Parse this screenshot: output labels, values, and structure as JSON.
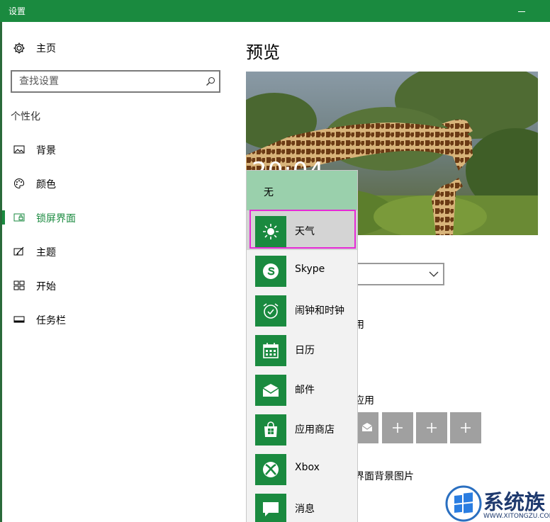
{
  "window": {
    "title": "设置"
  },
  "sidebar": {
    "home_label": "主页",
    "search_placeholder": "查找设置",
    "section_label": "个性化",
    "items": [
      {
        "label": "背景",
        "icon": "picture-icon"
      },
      {
        "label": "颜色",
        "icon": "palette-icon"
      },
      {
        "label": "锁屏界面",
        "icon": "lock-screen-icon",
        "active": true
      },
      {
        "label": "主题",
        "icon": "theme-icon"
      },
      {
        "label": "开始",
        "icon": "start-icon"
      },
      {
        "label": "任务栏",
        "icon": "taskbar-icon"
      }
    ]
  },
  "main": {
    "title": "预览",
    "preview_clock": "20:04",
    "partial_texts": [
      "用",
      "应用",
      "界面背景图片"
    ]
  },
  "dropdown": {
    "none_label": "无",
    "items": [
      {
        "label": "天气",
        "icon": "weather-sun-icon",
        "selected": true
      },
      {
        "label": "Skype",
        "icon": "skype-icon"
      },
      {
        "label": "闹钟和时钟",
        "icon": "alarm-clock-icon"
      },
      {
        "label": "日历",
        "icon": "calendar-icon"
      },
      {
        "label": "邮件",
        "icon": "mail-icon"
      },
      {
        "label": "应用商店",
        "icon": "store-icon"
      },
      {
        "label": "Xbox",
        "icon": "xbox-icon"
      },
      {
        "label": "消息",
        "icon": "message-icon"
      }
    ]
  },
  "watermark": {
    "text": "系统族",
    "subtext": "WWW.XITONGZU.COM"
  },
  "colors": {
    "accent": "#1a8a3f",
    "highlight": "#9ad0ac",
    "selection_outline": "#e62ad6"
  }
}
